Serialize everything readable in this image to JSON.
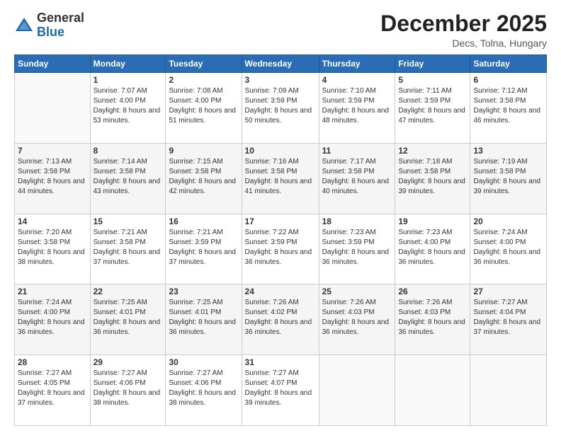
{
  "header": {
    "logo_general": "General",
    "logo_blue": "Blue",
    "month_title": "December 2025",
    "location": "Decs, Tolna, Hungary"
  },
  "weekdays": [
    "Sunday",
    "Monday",
    "Tuesday",
    "Wednesday",
    "Thursday",
    "Friday",
    "Saturday"
  ],
  "weeks": [
    [
      {
        "day": "",
        "sunrise": "",
        "sunset": "",
        "daylight": ""
      },
      {
        "day": "1",
        "sunrise": "Sunrise: 7:07 AM",
        "sunset": "Sunset: 4:00 PM",
        "daylight": "Daylight: 8 hours and 53 minutes."
      },
      {
        "day": "2",
        "sunrise": "Sunrise: 7:08 AM",
        "sunset": "Sunset: 4:00 PM",
        "daylight": "Daylight: 8 hours and 51 minutes."
      },
      {
        "day": "3",
        "sunrise": "Sunrise: 7:09 AM",
        "sunset": "Sunset: 3:59 PM",
        "daylight": "Daylight: 8 hours and 50 minutes."
      },
      {
        "day": "4",
        "sunrise": "Sunrise: 7:10 AM",
        "sunset": "Sunset: 3:59 PM",
        "daylight": "Daylight: 8 hours and 48 minutes."
      },
      {
        "day": "5",
        "sunrise": "Sunrise: 7:11 AM",
        "sunset": "Sunset: 3:59 PM",
        "daylight": "Daylight: 8 hours and 47 minutes."
      },
      {
        "day": "6",
        "sunrise": "Sunrise: 7:12 AM",
        "sunset": "Sunset: 3:58 PM",
        "daylight": "Daylight: 8 hours and 46 minutes."
      }
    ],
    [
      {
        "day": "7",
        "sunrise": "Sunrise: 7:13 AM",
        "sunset": "Sunset: 3:58 PM",
        "daylight": "Daylight: 8 hours and 44 minutes."
      },
      {
        "day": "8",
        "sunrise": "Sunrise: 7:14 AM",
        "sunset": "Sunset: 3:58 PM",
        "daylight": "Daylight: 8 hours and 43 minutes."
      },
      {
        "day": "9",
        "sunrise": "Sunrise: 7:15 AM",
        "sunset": "Sunset: 3:58 PM",
        "daylight": "Daylight: 8 hours and 42 minutes."
      },
      {
        "day": "10",
        "sunrise": "Sunrise: 7:16 AM",
        "sunset": "Sunset: 3:58 PM",
        "daylight": "Daylight: 8 hours and 41 minutes."
      },
      {
        "day": "11",
        "sunrise": "Sunrise: 7:17 AM",
        "sunset": "Sunset: 3:58 PM",
        "daylight": "Daylight: 8 hours and 40 minutes."
      },
      {
        "day": "12",
        "sunrise": "Sunrise: 7:18 AM",
        "sunset": "Sunset: 3:58 PM",
        "daylight": "Daylight: 8 hours and 39 minutes."
      },
      {
        "day": "13",
        "sunrise": "Sunrise: 7:19 AM",
        "sunset": "Sunset: 3:58 PM",
        "daylight": "Daylight: 8 hours and 39 minutes."
      }
    ],
    [
      {
        "day": "14",
        "sunrise": "Sunrise: 7:20 AM",
        "sunset": "Sunset: 3:58 PM",
        "daylight": "Daylight: 8 hours and 38 minutes."
      },
      {
        "day": "15",
        "sunrise": "Sunrise: 7:21 AM",
        "sunset": "Sunset: 3:58 PM",
        "daylight": "Daylight: 8 hours and 37 minutes."
      },
      {
        "day": "16",
        "sunrise": "Sunrise: 7:21 AM",
        "sunset": "Sunset: 3:59 PM",
        "daylight": "Daylight: 8 hours and 37 minutes."
      },
      {
        "day": "17",
        "sunrise": "Sunrise: 7:22 AM",
        "sunset": "Sunset: 3:59 PM",
        "daylight": "Daylight: 8 hours and 36 minutes."
      },
      {
        "day": "18",
        "sunrise": "Sunrise: 7:23 AM",
        "sunset": "Sunset: 3:59 PM",
        "daylight": "Daylight: 8 hours and 36 minutes."
      },
      {
        "day": "19",
        "sunrise": "Sunrise: 7:23 AM",
        "sunset": "Sunset: 4:00 PM",
        "daylight": "Daylight: 8 hours and 36 minutes."
      },
      {
        "day": "20",
        "sunrise": "Sunrise: 7:24 AM",
        "sunset": "Sunset: 4:00 PM",
        "daylight": "Daylight: 8 hours and 36 minutes."
      }
    ],
    [
      {
        "day": "21",
        "sunrise": "Sunrise: 7:24 AM",
        "sunset": "Sunset: 4:00 PM",
        "daylight": "Daylight: 8 hours and 36 minutes."
      },
      {
        "day": "22",
        "sunrise": "Sunrise: 7:25 AM",
        "sunset": "Sunset: 4:01 PM",
        "daylight": "Daylight: 8 hours and 36 minutes."
      },
      {
        "day": "23",
        "sunrise": "Sunrise: 7:25 AM",
        "sunset": "Sunset: 4:01 PM",
        "daylight": "Daylight: 8 hours and 36 minutes."
      },
      {
        "day": "24",
        "sunrise": "Sunrise: 7:26 AM",
        "sunset": "Sunset: 4:02 PM",
        "daylight": "Daylight: 8 hours and 36 minutes."
      },
      {
        "day": "25",
        "sunrise": "Sunrise: 7:26 AM",
        "sunset": "Sunset: 4:03 PM",
        "daylight": "Daylight: 8 hours and 36 minutes."
      },
      {
        "day": "26",
        "sunrise": "Sunrise: 7:26 AM",
        "sunset": "Sunset: 4:03 PM",
        "daylight": "Daylight: 8 hours and 36 minutes."
      },
      {
        "day": "27",
        "sunrise": "Sunrise: 7:27 AM",
        "sunset": "Sunset: 4:04 PM",
        "daylight": "Daylight: 8 hours and 37 minutes."
      }
    ],
    [
      {
        "day": "28",
        "sunrise": "Sunrise: 7:27 AM",
        "sunset": "Sunset: 4:05 PM",
        "daylight": "Daylight: 8 hours and 37 minutes."
      },
      {
        "day": "29",
        "sunrise": "Sunrise: 7:27 AM",
        "sunset": "Sunset: 4:06 PM",
        "daylight": "Daylight: 8 hours and 38 minutes."
      },
      {
        "day": "30",
        "sunrise": "Sunrise: 7:27 AM",
        "sunset": "Sunset: 4:06 PM",
        "daylight": "Daylight: 8 hours and 38 minutes."
      },
      {
        "day": "31",
        "sunrise": "Sunrise: 7:27 AM",
        "sunset": "Sunset: 4:07 PM",
        "daylight": "Daylight: 8 hours and 39 minutes."
      },
      {
        "day": "",
        "sunrise": "",
        "sunset": "",
        "daylight": ""
      },
      {
        "day": "",
        "sunrise": "",
        "sunset": "",
        "daylight": ""
      },
      {
        "day": "",
        "sunrise": "",
        "sunset": "",
        "daylight": ""
      }
    ]
  ]
}
